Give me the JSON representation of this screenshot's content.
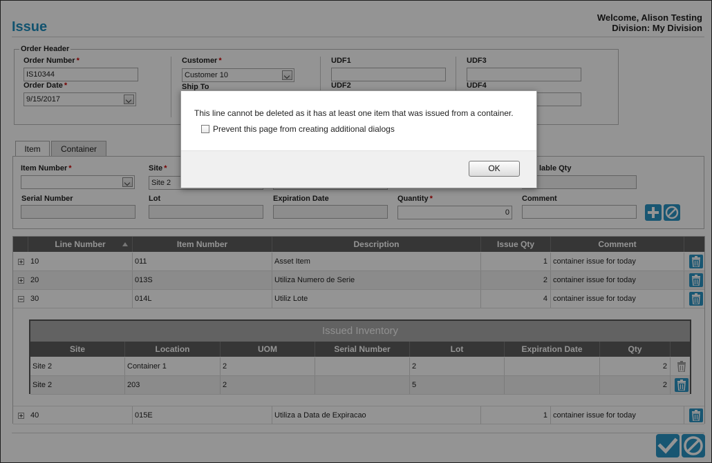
{
  "header": {
    "title": "Issue",
    "welcome": "Welcome, Alison Testing",
    "division": "Division: My Division"
  },
  "order_header": {
    "legend": "Order Header",
    "order_number_label": "Order Number",
    "order_number": "IS10344",
    "order_date_label": "Order Date",
    "order_date": "9/15/2017",
    "customer_label": "Customer",
    "customer": "Customer 10",
    "ship_to_label": "Ship To",
    "udf1": "UDF1",
    "udf2": "UDF2",
    "udf3": "UDF3",
    "udf4": "UDF4"
  },
  "tabs": {
    "item": "Item",
    "container": "Container"
  },
  "item_form": {
    "item_number_label": "Item Number",
    "site_label": "Site",
    "site_value": "Site 2",
    "available_qty_label": "lable Qty",
    "serial_number_label": "Serial Number",
    "lot_label": "Lot",
    "expiration_date_label": "Expiration Date",
    "quantity_label": "Quantity",
    "quantity_value": "0",
    "comment_label": "Comment"
  },
  "grid": {
    "columns": [
      "Line Number",
      "Item Number",
      "Description",
      "Issue Qty",
      "Comment"
    ],
    "rows": [
      {
        "line": "10",
        "item": "011",
        "desc": "Asset Item",
        "qty": "1",
        "comment": "container issue for today"
      },
      {
        "line": "20",
        "item": "013S",
        "desc": "Utiliza Numero de Serie",
        "qty": "2",
        "comment": "container issue for today"
      },
      {
        "line": "30",
        "item": "014L",
        "desc": "Utiliz Lote",
        "qty": "4",
        "comment": "container issue for today"
      },
      {
        "line": "40",
        "item": "015E",
        "desc": "Utiliza a Data de Expiracao",
        "qty": "1",
        "comment": "container issue for today"
      }
    ]
  },
  "issued_inventory": {
    "title": "Issued Inventory",
    "columns": [
      "Site",
      "Location",
      "UOM",
      "Serial Number",
      "Lot",
      "Expiration Date",
      "Qty"
    ],
    "rows": [
      {
        "site": "Site 2",
        "location": "Container 1",
        "uom": "2",
        "serial": "",
        "lot": "2",
        "exp": "",
        "qty": "2"
      },
      {
        "site": "Site 2",
        "location": "203",
        "uom": "2",
        "serial": "",
        "lot": "5",
        "exp": "",
        "qty": "2"
      }
    ]
  },
  "dialog": {
    "message": "This line cannot be deleted as it has at least one item that was issued from a container.",
    "checkbox_label": "Prevent this page from creating additional dialogs",
    "ok_label": "OK"
  },
  "colors": {
    "accent": "#2a94c5",
    "title": "#1f8fc0"
  }
}
